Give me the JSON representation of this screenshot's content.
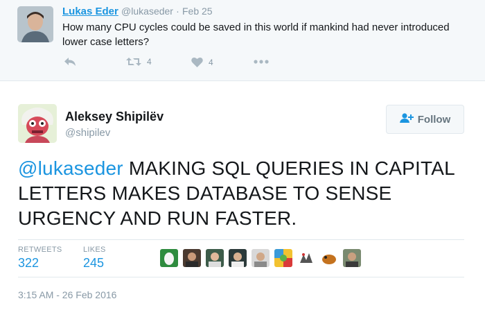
{
  "parent_tweet": {
    "author_name": "Lukas Eder",
    "author_handle": "@lukaseder",
    "separator": "·",
    "time": "Feb 25",
    "text": "How many CPU cycles could be saved in this world if mankind had never introduced lower case letters?",
    "retweet_count": "4",
    "like_count": "4"
  },
  "main_tweet": {
    "author_name": "Aleksey Shipilëv",
    "author_handle": "@shipilev",
    "follow_label": "Follow",
    "mention": "@lukaseder",
    "text": " MAKING SQL QUERIES IN CAPITAL LETTERS MAKES DATABASE TO SENSE URGENCY AND RUN FASTER.",
    "stats": {
      "retweets_label": "RETWEETS",
      "retweets_value": "322",
      "likes_label": "LIKES",
      "likes_value": "245"
    },
    "likers_count": 9,
    "timestamp": "3:15 AM - 26 Feb 2016"
  },
  "colors": {
    "link_blue": "#1b95e0",
    "muted_gray": "#8899a6",
    "parent_bg": "#f5f8fa"
  }
}
